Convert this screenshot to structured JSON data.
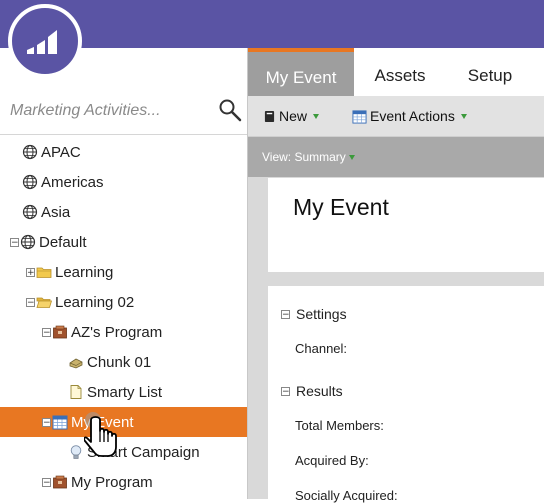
{
  "brand": {
    "bar_color": "#5a54a4",
    "accent_color": "#e87722"
  },
  "search": {
    "placeholder": "Marketing Activities..."
  },
  "tree": [
    {
      "label": "APAC",
      "icon": "globe-icon",
      "expander": ""
    },
    {
      "label": "Americas",
      "icon": "globe-icon",
      "expander": ""
    },
    {
      "label": "Asia",
      "icon": "globe-icon",
      "expander": ""
    },
    {
      "label": "Default",
      "icon": "globe-icon",
      "expander": "−"
    },
    {
      "label": "Learning",
      "icon": "folder-icon",
      "expander": "+"
    },
    {
      "label": "Learning 02",
      "icon": "folder-icon",
      "expander": "−"
    },
    {
      "label": "AZ's Program",
      "icon": "program-icon",
      "expander": "−"
    },
    {
      "label": "Chunk 01",
      "icon": "chunk-icon",
      "expander": ""
    },
    {
      "label": "Smarty List",
      "icon": "smart-list-icon",
      "expander": ""
    },
    {
      "label": "My Event",
      "icon": "calendar-icon",
      "expander": "−",
      "selected": true
    },
    {
      "label": "Smart Campaign",
      "icon": "lightbulb-icon",
      "expander": ""
    },
    {
      "label": "My Program",
      "icon": "program-icon",
      "expander": "−"
    }
  ],
  "tabs": [
    {
      "label": "My Event",
      "active": true
    },
    {
      "label": "Assets",
      "active": false
    },
    {
      "label": "Setup",
      "active": false
    }
  ],
  "toolbar": {
    "new_label": "New",
    "event_actions_label": "Event Actions"
  },
  "view": {
    "label": "View: Summary"
  },
  "panel": {
    "title": "My Event",
    "settings_label": "Settings",
    "channel_label": "Channel:",
    "results_label": "Results",
    "total_members_label": "Total Members:",
    "acquired_by_label": "Acquired By:",
    "socially_acquired_label": "Socially Acquired:"
  }
}
